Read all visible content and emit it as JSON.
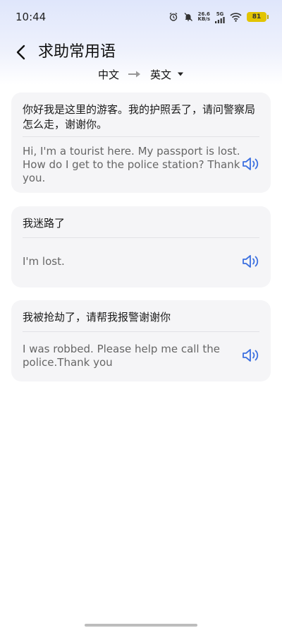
{
  "status_bar": {
    "time": "10:44",
    "net_speed_value": "26.6",
    "net_speed_unit": "KB/s",
    "network": "5G",
    "battery": "81"
  },
  "header": {
    "title": "求助常用语"
  },
  "language": {
    "from": "中文",
    "to": "英文"
  },
  "phrases": [
    {
      "source": "你好我是这里的游客。我的护照丢了，请问警察局怎么走，谢谢你。",
      "translation": "Hi, I'm a tourist here.  My passport is lost. How do I get to the police station? Thank you."
    },
    {
      "source": "我迷路了",
      "translation": "I'm lost."
    },
    {
      "source": "我被抢劫了，请帮我报警谢谢你",
      "translation": "I was robbed. Please help me call the police.Thank you"
    }
  ],
  "colors": {
    "accent": "#3b6fe0",
    "card_bg": "#f5f5f7"
  }
}
